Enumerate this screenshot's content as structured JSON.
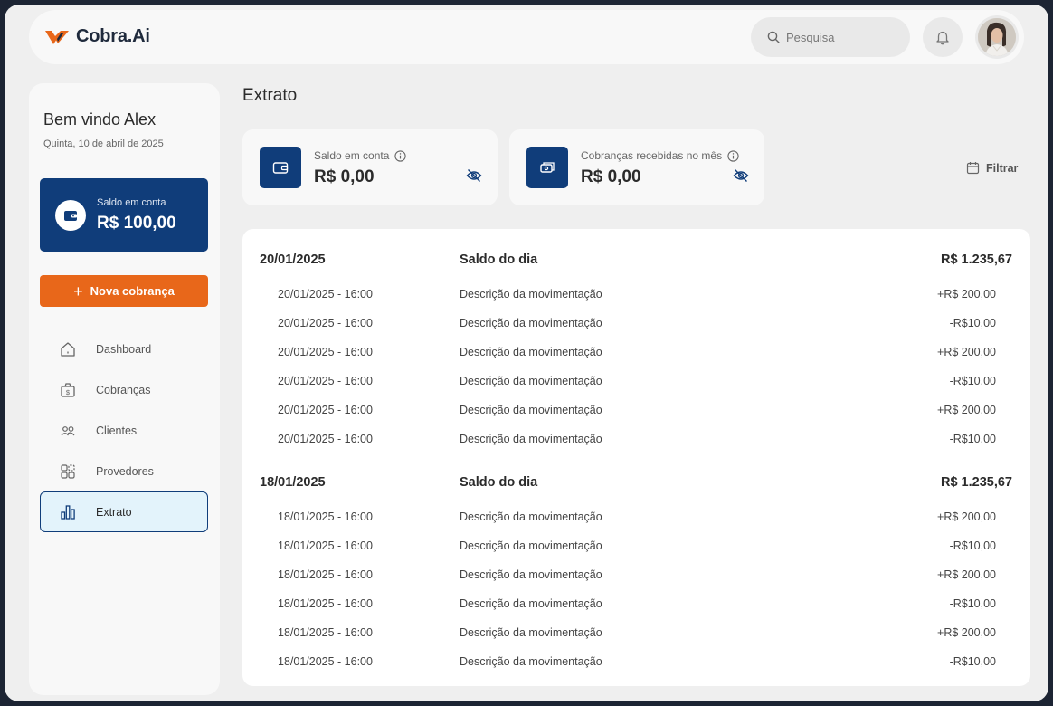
{
  "app": {
    "name": "Cobra.Ai"
  },
  "header": {
    "search_placeholder": "Pesquisa",
    "notification_icon": "bell-icon",
    "avatar_icon": "user-avatar"
  },
  "colors": {
    "primary": "#103d7a",
    "accent": "#e8671a",
    "active_bg": "#e3f3fb"
  },
  "sidebar": {
    "welcome": "Bem vindo Alex",
    "date": "Quinta, 10 de abril de 2025",
    "balance_label": "Saldo em conta",
    "balance_value": "R$ 100,00",
    "new_button": "Nova cobrança",
    "nav": [
      {
        "label": "Dashboard",
        "icon": "home-icon",
        "active": false
      },
      {
        "label": "Cobranças",
        "icon": "money-bag-icon",
        "active": false
      },
      {
        "label": "Clientes",
        "icon": "users-icon",
        "active": false
      },
      {
        "label": "Provedores",
        "icon": "providers-icon",
        "active": false
      },
      {
        "label": "Extrato",
        "icon": "bar-chart-icon",
        "active": true
      }
    ]
  },
  "main": {
    "title": "Extrato",
    "kpis": [
      {
        "label": "Saldo em conta",
        "value": "R$ 0,00",
        "icon": "wallet-icon"
      },
      {
        "label": "Cobranças recebidas no mês",
        "value": "R$ 0,00",
        "icon": "cash-icon"
      }
    ],
    "filter_label": "Filtrar",
    "groups": [
      {
        "date": "20/01/2025",
        "label": "Saldo do dia",
        "amount": "R$ 1.235,67",
        "rows": [
          {
            "date": "20/01/2025 - 16:00",
            "desc": "Descrição da movimentação",
            "amount": "+R$ 200,00"
          },
          {
            "date": "20/01/2025 - 16:00",
            "desc": "Descrição da movimentação",
            "amount": "-R$10,00"
          },
          {
            "date": "20/01/2025 - 16:00",
            "desc": "Descrição da movimentação",
            "amount": "+R$ 200,00"
          },
          {
            "date": "20/01/2025 - 16:00",
            "desc": "Descrição da movimentação",
            "amount": "-R$10,00"
          },
          {
            "date": "20/01/2025 - 16:00",
            "desc": "Descrição da movimentação",
            "amount": "+R$ 200,00"
          },
          {
            "date": "20/01/2025 - 16:00",
            "desc": "Descrição da movimentação",
            "amount": "-R$10,00"
          }
        ]
      },
      {
        "date": "18/01/2025",
        "label": "Saldo do dia",
        "amount": "R$ 1.235,67",
        "rows": [
          {
            "date": "18/01/2025 - 16:00",
            "desc": "Descrição da movimentação",
            "amount": "+R$ 200,00"
          },
          {
            "date": "18/01/2025 - 16:00",
            "desc": "Descrição da movimentação",
            "amount": "-R$10,00"
          },
          {
            "date": "18/01/2025 - 16:00",
            "desc": "Descrição da movimentação",
            "amount": "+R$ 200,00"
          },
          {
            "date": "18/01/2025 - 16:00",
            "desc": "Descrição da movimentação",
            "amount": "-R$10,00"
          },
          {
            "date": "18/01/2025 - 16:00",
            "desc": "Descrição da movimentação",
            "amount": "+R$ 200,00"
          },
          {
            "date": "18/01/2025 - 16:00",
            "desc": "Descrição da movimentação",
            "amount": "-R$10,00"
          }
        ]
      }
    ]
  }
}
